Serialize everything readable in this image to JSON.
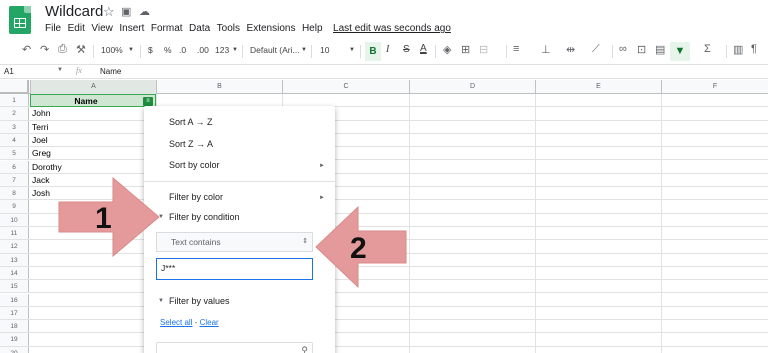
{
  "app": {
    "title": "Wildcard",
    "last_edit": "Last edit was seconds ago",
    "menu": [
      "File",
      "Edit",
      "View",
      "Insert",
      "Format",
      "Data",
      "Tools",
      "Extensions",
      "Help"
    ]
  },
  "toolbar": {
    "zoom": "100%",
    "currency": "$",
    "percent": "%",
    "dec_less": ".0",
    "dec_more": ".00",
    "more_formats": "123",
    "font": "Default (Ari...",
    "font_size": "10",
    "bold": "B",
    "italic": "I",
    "strike": "S",
    "text_color": "A"
  },
  "formula_bar": {
    "cell_ref": "A1",
    "fx": "fx",
    "content": "Name"
  },
  "columns": [
    "A",
    "B",
    "C",
    "D",
    "E",
    "F"
  ],
  "rows": [
    {
      "num": "1",
      "a": "Name"
    },
    {
      "num": "2",
      "a": "John"
    },
    {
      "num": "3",
      "a": "Terri"
    },
    {
      "num": "4",
      "a": "Joel"
    },
    {
      "num": "5",
      "a": "Greg"
    },
    {
      "num": "6",
      "a": "Dorothy"
    },
    {
      "num": "7",
      "a": "Jack"
    },
    {
      "num": "8",
      "a": "Josh"
    },
    {
      "num": "9",
      "a": ""
    },
    {
      "num": "10",
      "a": ""
    },
    {
      "num": "11",
      "a": ""
    },
    {
      "num": "12",
      "a": ""
    },
    {
      "num": "13",
      "a": ""
    },
    {
      "num": "14",
      "a": ""
    },
    {
      "num": "15",
      "a": ""
    },
    {
      "num": "16",
      "a": ""
    },
    {
      "num": "17",
      "a": ""
    },
    {
      "num": "18",
      "a": ""
    },
    {
      "num": "19",
      "a": ""
    },
    {
      "num": "20",
      "a": ""
    }
  ],
  "filter_menu": {
    "sort_az": "Sort A → Z",
    "sort_za": "Sort Z → A",
    "sort_color": "Sort by color",
    "filter_color": "Filter by color",
    "filter_condition": "Filter by condition",
    "condition_value": "Text contains",
    "input_value": "J***",
    "filter_values": "Filter by values",
    "select_all": "Select all",
    "clear": "Clear",
    "separator": " - "
  },
  "annotations": [
    "1",
    "2"
  ],
  "colors": {
    "accent_green": "#1e8e3e",
    "arrow": "#e8a0a0",
    "focus_blue": "#1a73e8"
  }
}
